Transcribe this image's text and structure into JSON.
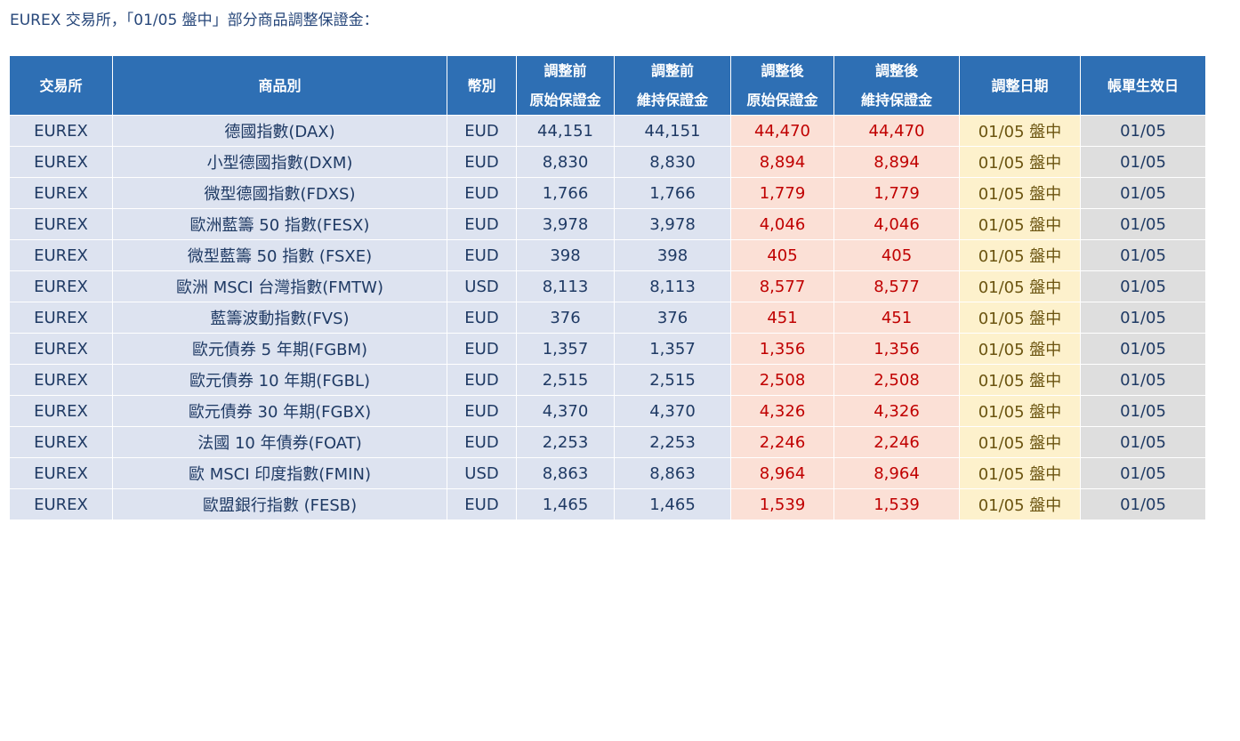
{
  "title": "EUREX 交易所，「01/05 盤中」部分商品調整保證金：",
  "table": {
    "headers": {
      "exchange": "交易所",
      "product": "商品別",
      "currency": "幣別",
      "pre_initial_line1": "調整前",
      "pre_initial_line2": "原始保證金",
      "pre_maint_line1": "調整前",
      "pre_maint_line2": "維持保證金",
      "post_initial_line1": "調整後",
      "post_initial_line2": "原始保證金",
      "post_maint_line1": "調整後",
      "post_maint_line2": "維持保證金",
      "adjust_date": "調整日期",
      "effective_date": "帳單生效日"
    },
    "rows": [
      [
        "EUREX",
        "德國指數(DAX)",
        "EUD",
        "44,151",
        "44,151",
        "44,470",
        "44,470",
        "01/05 盤中",
        "01/05"
      ],
      [
        "EUREX",
        "小型德國指數(DXM)",
        "EUD",
        "8,830",
        "8,830",
        "8,894",
        "8,894",
        "01/05 盤中",
        "01/05"
      ],
      [
        "EUREX",
        "微型德國指數(FDXS)",
        "EUD",
        "1,766",
        "1,766",
        "1,779",
        "1,779",
        "01/05 盤中",
        "01/05"
      ],
      [
        "EUREX",
        "歐洲藍籌 50 指數(FESX)",
        "EUD",
        "3,978",
        "3,978",
        "4,046",
        "4,046",
        "01/05 盤中",
        "01/05"
      ],
      [
        "EUREX",
        "微型藍籌 50 指數 (FSXE)",
        "EUD",
        "398",
        "398",
        "405",
        "405",
        "01/05 盤中",
        "01/05"
      ],
      [
        "EUREX",
        "歐洲 MSCI 台灣指數(FMTW)",
        "USD",
        "8,113",
        "8,113",
        "8,577",
        "8,577",
        "01/05 盤中",
        "01/05"
      ],
      [
        "EUREX",
        "藍籌波動指數(FVS)",
        "EUD",
        "376",
        "376",
        "451",
        "451",
        "01/05 盤中",
        "01/05"
      ],
      [
        "EUREX",
        "歐元債券 5 年期(FGBM)",
        "EUD",
        "1,357",
        "1,357",
        "1,356",
        "1,356",
        "01/05 盤中",
        "01/05"
      ],
      [
        "EUREX",
        "歐元債券 10 年期(FGBL)",
        "EUD",
        "2,515",
        "2,515",
        "2,508",
        "2,508",
        "01/05 盤中",
        "01/05"
      ],
      [
        "EUREX",
        "歐元債券 30 年期(FGBX)",
        "EUD",
        "4,370",
        "4,370",
        "4,326",
        "4,326",
        "01/05 盤中",
        "01/05"
      ],
      [
        "EUREX",
        "法國 10 年債券(FOAT)",
        "EUD",
        "2,253",
        "2,253",
        "2,246",
        "2,246",
        "01/05 盤中",
        "01/05"
      ],
      [
        "EUREX",
        "歐 MSCI 印度指數(FMIN)",
        "USD",
        "8,863",
        "8,863",
        "8,964",
        "8,964",
        "01/05 盤中",
        "01/05"
      ],
      [
        "EUREX",
        "歐盟銀行指數 (FESB)",
        "EUD",
        "1,465",
        "1,465",
        "1,539",
        "1,539",
        "01/05 盤中",
        "01/05"
      ]
    ]
  },
  "colors": {
    "header_bg": "#2e6fb4",
    "base_cell_bg": "#dde3f0",
    "after_cell_bg": "#fbe0d6",
    "after_text": "#c00000",
    "date_cell_bg": "#fdf1cc",
    "effective_cell_bg": "#dedede"
  }
}
